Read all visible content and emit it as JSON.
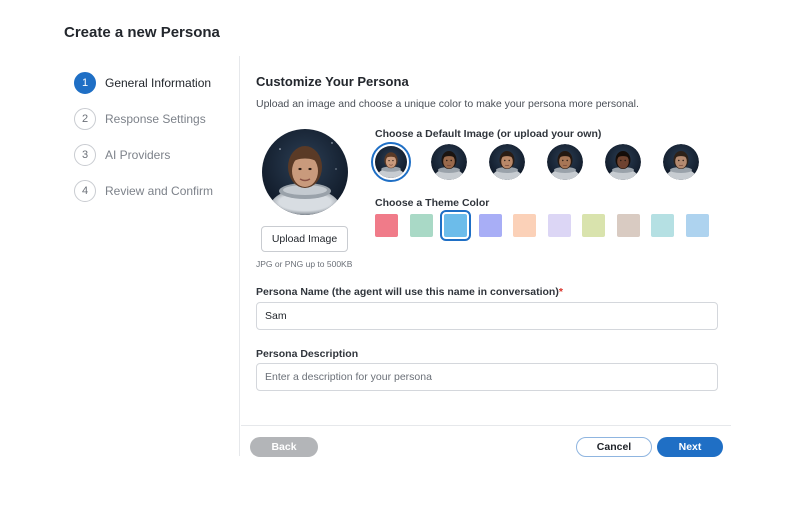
{
  "page_title": "Create a new Persona",
  "steps": [
    {
      "num": "1",
      "label": "General Information",
      "active": true
    },
    {
      "num": "2",
      "label": "Response Settings",
      "active": false
    },
    {
      "num": "3",
      "label": "AI Providers",
      "active": false
    },
    {
      "num": "4",
      "label": "Review and Confirm",
      "active": false
    }
  ],
  "section": {
    "title": "Customize Your Persona",
    "subtitle": "Upload an image and choose a unique color to make your persona more personal."
  },
  "upload": {
    "button_label": "Upload Image",
    "hint": "JPG or PNG up to 500KB"
  },
  "default_image": {
    "label": "Choose a Default Image (or upload your own)",
    "selected_index": 0,
    "thumbnails": [
      {
        "skin": "#c99a7c",
        "hair": "#5a3a26"
      },
      {
        "skin": "#9a6a4c",
        "hair": "#1b1410"
      },
      {
        "skin": "#b98868",
        "hair": "#2a1c14"
      },
      {
        "skin": "#a77656",
        "hair": "#241811"
      },
      {
        "skin": "#6e4330",
        "hair": "#140d09"
      },
      {
        "skin": "#b48a70",
        "hair": "#2e2219"
      }
    ]
  },
  "theme_color": {
    "label": "Choose a Theme Color",
    "selected_index": 2,
    "swatches": [
      "#f07b89",
      "#a9d9c6",
      "#6cbcea",
      "#a8aef6",
      "#fbd1b8",
      "#dcd6f5",
      "#d9e3ad",
      "#d9cbc2",
      "#b5e0e3",
      "#aed3ef"
    ]
  },
  "persona_name": {
    "label": "Persona Name (the agent will use this name in conversation)",
    "required_mark": "*",
    "value": "Sam"
  },
  "persona_description": {
    "label": "Persona Description",
    "placeholder": "Enter a description for your persona",
    "value": ""
  },
  "footer": {
    "back_label": "Back",
    "cancel_label": "Cancel",
    "next_label": "Next"
  }
}
